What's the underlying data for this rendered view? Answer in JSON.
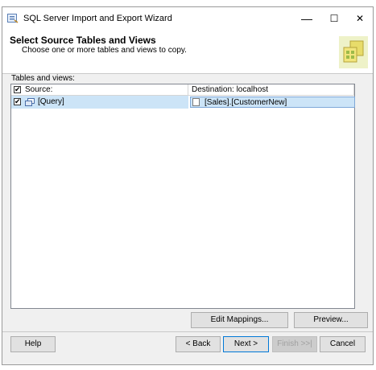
{
  "window": {
    "title": "SQL Server Import and Export Wizard",
    "minimize_glyph": "—",
    "maximize_glyph": "☐",
    "close_glyph": "✕"
  },
  "header": {
    "title": "Select Source Tables and Views",
    "subtitle": "Choose one or more tables and views to copy."
  },
  "tables": {
    "label": "Tables and views:",
    "columns": {
      "source": "Source:",
      "destination": "Destination: localhost"
    },
    "header_checked": "✔",
    "rows": [
      {
        "checked": "✔",
        "source": "[Query]",
        "destination": "[Sales].[CustomerNew]"
      }
    ]
  },
  "actions": {
    "edit_mappings": "Edit Mappings...",
    "preview": "Preview..."
  },
  "footer": {
    "help": "Help",
    "back": "< Back",
    "next": "Next >",
    "finish": "Finish >>|",
    "cancel": "Cancel"
  },
  "colors": {
    "selection": "#cce4f7",
    "accent": "#0078d7"
  }
}
